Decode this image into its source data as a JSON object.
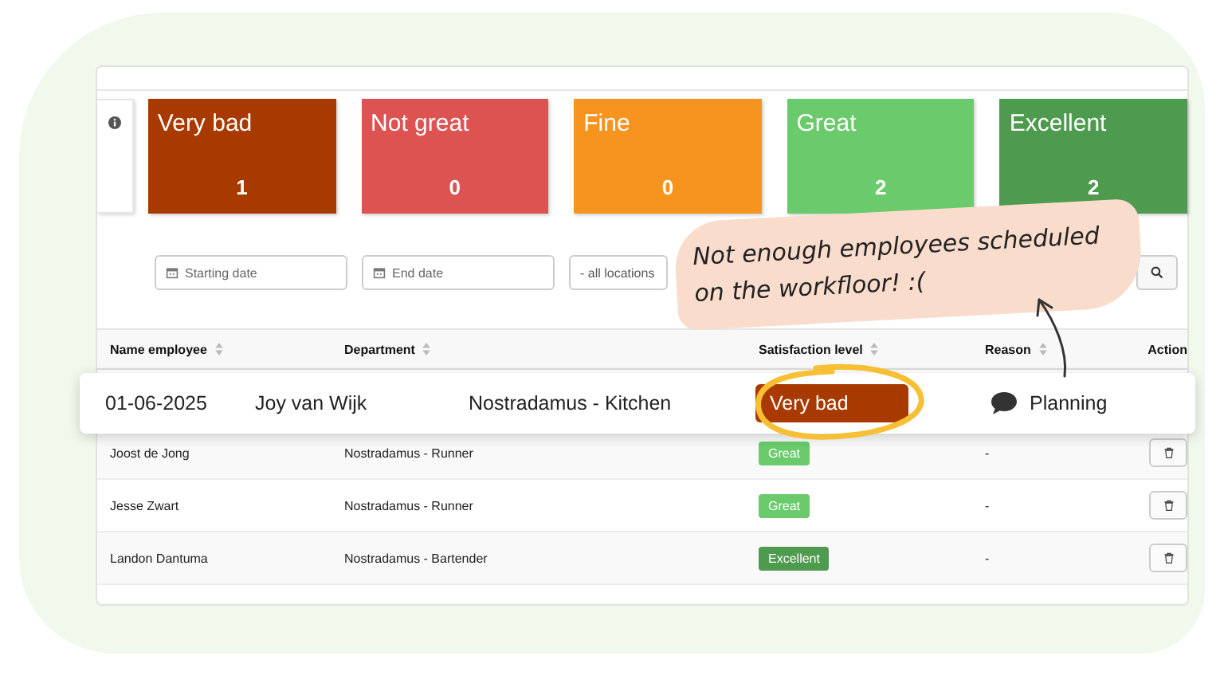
{
  "tiles": [
    {
      "label": "Very bad",
      "count": "1",
      "color": "#a83a00"
    },
    {
      "label": "Not great",
      "count": "0",
      "color": "#dc5352"
    },
    {
      "label": "Fine",
      "count": "0",
      "color": "#f7941f"
    },
    {
      "label": "Great",
      "count": "2",
      "color": "#6aca6c"
    },
    {
      "label": "Excellent",
      "count": "2",
      "color": "#4e9a4f"
    }
  ],
  "filters": {
    "start_date": {
      "placeholder": "Starting date"
    },
    "end_date": {
      "placeholder": "End date"
    },
    "location": {
      "value": "- all locations"
    }
  },
  "table": {
    "columns": [
      "Name employee",
      "Department",
      "Satisfaction level",
      "Reason",
      "Action"
    ],
    "rows": [
      {
        "name": "Joost de Jong",
        "department": "Nostradamus -  Runner",
        "satisfaction": "Great",
        "color": "#6aca6c",
        "reason": "-"
      },
      {
        "name": "Jesse Zwart",
        "department": "Nostradamus -  Runner",
        "satisfaction": "Great",
        "color": "#6aca6c",
        "reason": "-"
      },
      {
        "name": "Landon Dantuma",
        "department": "Nostradamus -  Bartender",
        "satisfaction": "Excellent",
        "color": "#4e9a4f",
        "reason": "-"
      }
    ]
  },
  "highlight": {
    "date": "01-06-2025",
    "name": "Joy van Wijk",
    "department": "Nostradamus - Kitchen",
    "satisfaction": "Very bad",
    "color": "#a83a00",
    "reason": "Planning"
  },
  "note": {
    "text": "Not enough employees scheduled on the workfloor! :("
  }
}
